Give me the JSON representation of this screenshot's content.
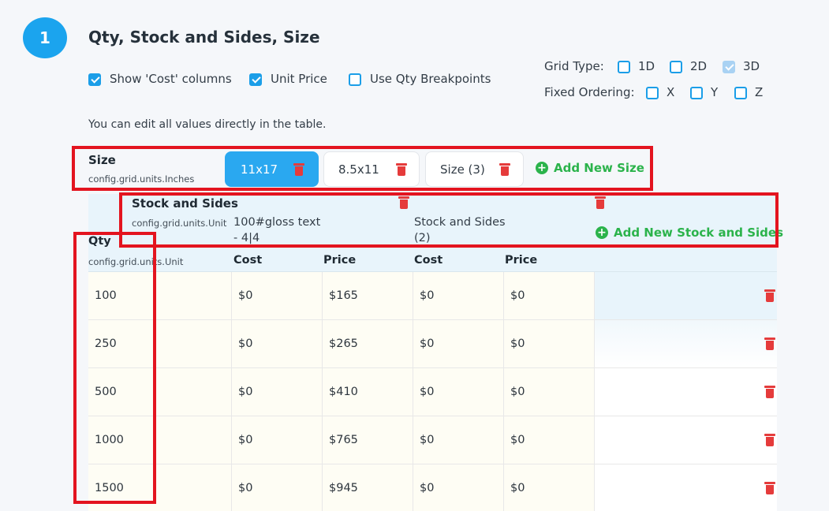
{
  "step_number": "1",
  "section_title": "Qty, Stock and Sides, Size",
  "options": {
    "show_cost_columns": {
      "label": "Show 'Cost' columns",
      "checked": true
    },
    "unit_price": {
      "label": "Unit Price",
      "checked": true
    },
    "use_qty_breakpoints": {
      "label": "Use Qty Breakpoints",
      "checked": false
    }
  },
  "grid_type": {
    "label": "Grid Type:",
    "options": [
      {
        "label": "1D",
        "checked": false
      },
      {
        "label": "2D",
        "checked": false
      },
      {
        "label": "3D",
        "checked": true
      }
    ]
  },
  "fixed_ordering": {
    "label": "Fixed Ordering:",
    "options": [
      {
        "label": "X",
        "checked": false
      },
      {
        "label": "Y",
        "checked": false
      },
      {
        "label": "Z",
        "checked": false
      }
    ]
  },
  "hint": "You can edit all values directly in the table.",
  "size": {
    "title": "Size",
    "unit": "config.grid.units.Inches",
    "chips": [
      {
        "label": "11x17",
        "active": true
      },
      {
        "label": "8.5x11",
        "active": false
      },
      {
        "label": "Size (3)",
        "active": false
      }
    ],
    "add_label": "Add New Size"
  },
  "stock": {
    "title": "Stock and Sides",
    "unit": "config.grid.units.Unit",
    "items": [
      {
        "line1": "100#gloss text",
        "line2": "- 4|4"
      },
      {
        "line1": "Stock and Sides",
        "line2": "(2)"
      }
    ],
    "add_label": "Add New Stock and Sides"
  },
  "qty": {
    "title": "Qty",
    "unit": "config.grid.units.Unit"
  },
  "column_headers": [
    "Cost",
    "Price",
    "Cost",
    "Price"
  ],
  "rows": [
    {
      "qty": "100",
      "values": [
        "$0",
        "$165",
        "$0",
        "$0"
      ]
    },
    {
      "qty": "250",
      "values": [
        "$0",
        "$265",
        "$0",
        "$0"
      ]
    },
    {
      "qty": "500",
      "values": [
        "$0",
        "$410",
        "$0",
        "$0"
      ]
    },
    {
      "qty": "1000",
      "values": [
        "$0",
        "$765",
        "$0",
        "$0"
      ]
    },
    {
      "qty": "1500",
      "values": [
        "$0",
        "$945",
        "$0",
        "$0"
      ]
    }
  ],
  "colors": {
    "accent": "#1ba4ee",
    "add_green": "#2bb34b",
    "delete_red": "#e53b3b",
    "highlight_red": "#e3141f"
  },
  "icons": {
    "delete": "trash-icon",
    "add": "plus-circle-icon",
    "checkbox": "checkbox"
  }
}
